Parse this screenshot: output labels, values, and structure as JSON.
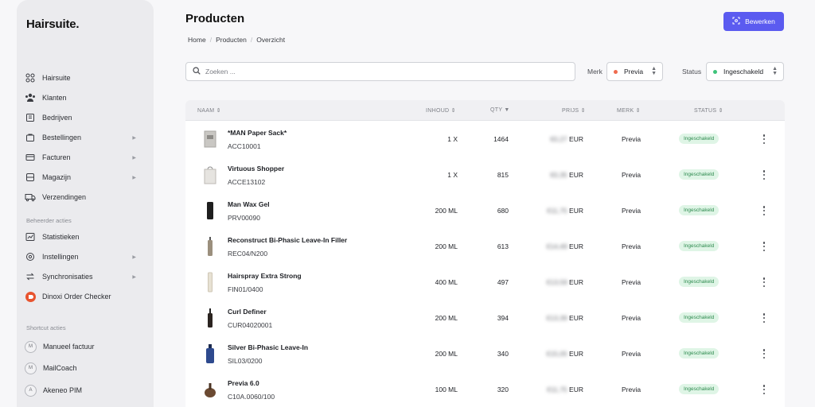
{
  "app": {
    "logo": "Hairsuite."
  },
  "sidebar": {
    "items": [
      {
        "label": "Hairsuite",
        "icon": "grid-icon"
      },
      {
        "label": "Klanten",
        "icon": "users-icon"
      },
      {
        "label": "Bedrijven",
        "icon": "building-icon"
      },
      {
        "label": "Bestellingen",
        "icon": "cart-icon",
        "chevron": "▶"
      },
      {
        "label": "Facturen",
        "icon": "invoice-icon",
        "chevron": "▶"
      },
      {
        "label": "Magazijn",
        "icon": "warehouse-icon",
        "chevron": "▶"
      },
      {
        "label": "Verzendingen",
        "icon": "truck-icon"
      }
    ],
    "admin_section": "Beheerder acties",
    "admin_items": [
      {
        "label": "Statistieken",
        "icon": "chart-icon"
      },
      {
        "label": "Instellingen",
        "icon": "settings-icon",
        "chevron": "▶"
      },
      {
        "label": "Synchronisaties",
        "icon": "sync-icon",
        "chevron": "▶"
      },
      {
        "label": "Dinoxi Order Checker",
        "icon": "dinoxi-logo-icon"
      }
    ],
    "shortcut_section": "Shortcut acties",
    "shortcuts": [
      {
        "badge": "M",
        "label": "Manueel factuur"
      },
      {
        "badge": "M",
        "label": "MailCoach"
      },
      {
        "badge": "A",
        "label": "Akeneo PIM"
      }
    ]
  },
  "header": {
    "title": "Producten",
    "breadcrumb": [
      "Home",
      "Producten",
      "Overzicht"
    ],
    "edit_button": "Bewerken"
  },
  "filters": {
    "search_placeholder": "Zoeken ...",
    "brand_label": "Merk",
    "brand_value": "Previa",
    "brand_dot_color": "#ef6b4e",
    "status_label": "Status",
    "status_value": "Ingeschakeld",
    "status_dot_color": "#3ec47a"
  },
  "table": {
    "columns": {
      "name": "NAAM",
      "content": "INHOUD",
      "qty": "QTY",
      "price": "PRIJS",
      "brand": "MERK",
      "status": "STATUS"
    },
    "rows": [
      {
        "name": "*MAN Paper Sack*",
        "sku": "ACC10001",
        "content": "1 X",
        "qty": "1464",
        "price": "€0,27",
        "currency": "EUR",
        "brand": "Previa",
        "status": "Ingeschakeld",
        "thumb": "paper-sack"
      },
      {
        "name": "Virtuous Shopper",
        "sku": "ACCE13102",
        "content": "1 X",
        "qty": "815",
        "price": "€0,35",
        "currency": "EUR",
        "brand": "Previa",
        "status": "Ingeschakeld",
        "thumb": "shopper-bag"
      },
      {
        "name": "Man Wax Gel",
        "sku": "PRV00090",
        "content": "200 ML",
        "qty": "680",
        "price": "€11,75",
        "currency": "EUR",
        "brand": "Previa",
        "status": "Ingeschakeld",
        "thumb": "black-tube"
      },
      {
        "name": "Reconstruct Bi-Phasic Leave-In Filler",
        "sku": "REC04/N200",
        "content": "200 ML",
        "qty": "613",
        "price": "€14,49",
        "currency": "EUR",
        "brand": "Previa",
        "status": "Ingeschakeld",
        "thumb": "spray-bottle"
      },
      {
        "name": "Hairspray Extra Strong",
        "sku": "FIN01/0400",
        "content": "400 ML",
        "qty": "497",
        "price": "€13,59",
        "currency": "EUR",
        "brand": "Previa",
        "status": "Ingeschakeld",
        "thumb": "spray-can"
      },
      {
        "name": "Curl Definer",
        "sku": "CUR04020001",
        "content": "200 ML",
        "qty": "394",
        "price": "€13,39",
        "currency": "EUR",
        "brand": "Previa",
        "status": "Ingeschakeld",
        "thumb": "dark-bottle"
      },
      {
        "name": "Silver Bi-Phasic Leave-In",
        "sku": "SIL03/0200",
        "content": "200 ML",
        "qty": "340",
        "price": "€15,05",
        "currency": "EUR",
        "brand": "Previa",
        "status": "Ingeschakeld",
        "thumb": "blue-bottle"
      },
      {
        "name": "Previa 6.0",
        "sku": "C10A.0060/100",
        "content": "100 ML",
        "qty": "320",
        "price": "€11,75",
        "currency": "EUR",
        "brand": "Previa",
        "status": "Ingeschakeld",
        "thumb": "color-tube"
      }
    ]
  },
  "colors": {
    "accent": "#5b5bf0",
    "status_bg": "#dff5e6",
    "status_text": "#2d8a4e"
  }
}
